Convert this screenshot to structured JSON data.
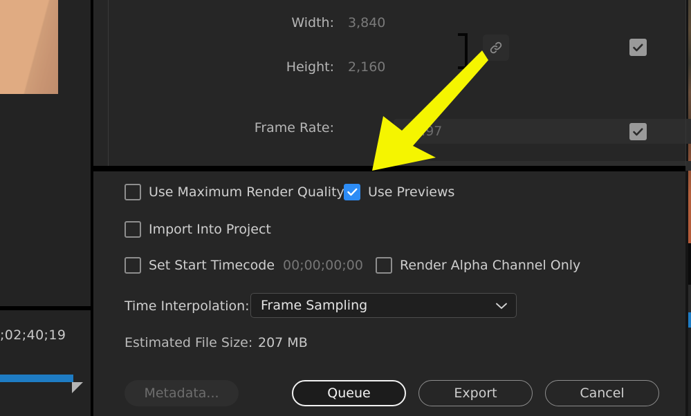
{
  "colors": {
    "dialog_bg": "#262626",
    "accent_blue": "#2d8cf5",
    "progress_blue": "#1e7cc4",
    "annotation_yellow": "#f5f500",
    "text_primary": "#cfcfcf",
    "text_dim": "#6e6e6e"
  },
  "left_panel": {
    "timecode": ";02;40;19"
  },
  "settings": {
    "width": {
      "label": "Width:",
      "value": "3,840"
    },
    "height": {
      "label": "Height:",
      "value": "2,160"
    },
    "frame_rate": {
      "label": "Frame Rate:",
      "value": "29.97"
    },
    "link_icon": "link-icon",
    "chevron_icon": "chevron-down-icon"
  },
  "options": {
    "use_maximum_render_quality": {
      "label": "Use Maximum Render Quality",
      "checked": false
    },
    "use_previews": {
      "label": "Use Previews",
      "checked": true
    },
    "import_into_project": {
      "label": "Import Into Project",
      "checked": false
    },
    "set_start_timecode": {
      "label": "Set Start Timecode",
      "value": "00;00;00;00",
      "checked": false
    },
    "render_alpha_channel_only": {
      "label": "Render Alpha Channel Only",
      "checked": false
    },
    "time_interpolation": {
      "label": "Time Interpolation:",
      "value": "Frame Sampling"
    },
    "estimated_file_size": {
      "label": "Estimated File Size:",
      "value": "207 MB"
    }
  },
  "buttons": {
    "metadata": "Metadata...",
    "queue": "Queue",
    "export": "Export",
    "cancel": "Cancel"
  },
  "annotation": {
    "arrow_name": "yellow-pointer-arrow",
    "points_to": "Use Previews"
  }
}
